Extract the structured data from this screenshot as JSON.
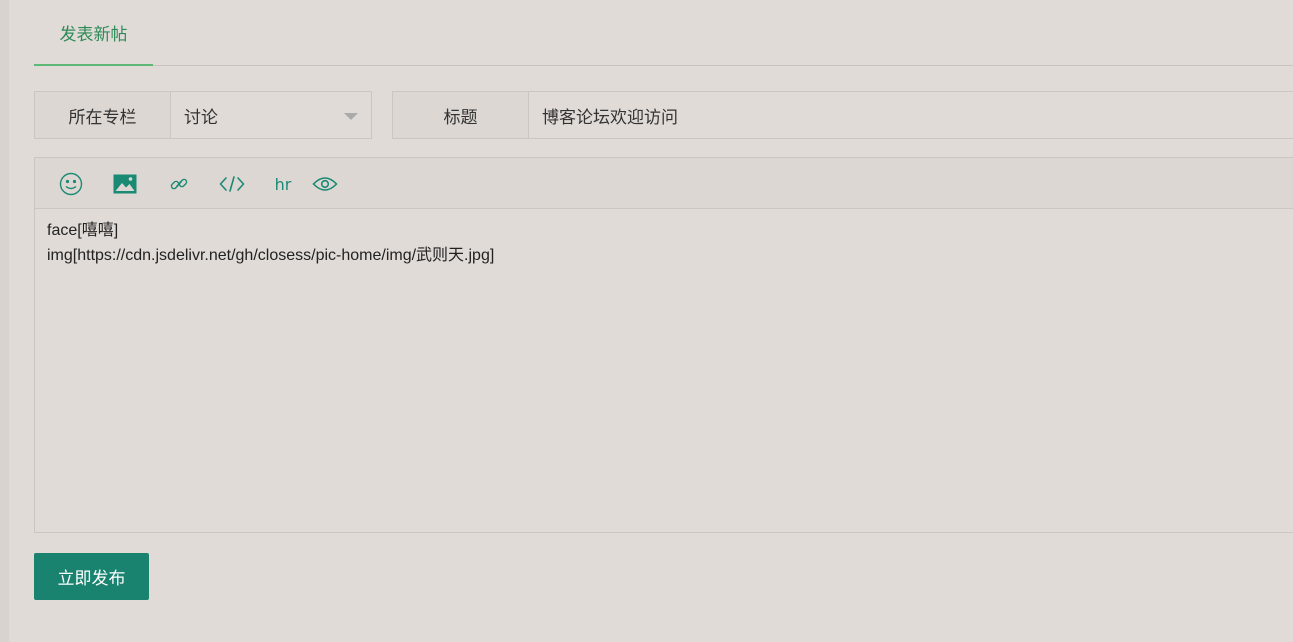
{
  "tabs": [
    {
      "label": "发表新帖",
      "active": true
    }
  ],
  "category": {
    "label": "所在专栏",
    "selected": "讨论"
  },
  "title": {
    "label": "标题",
    "value": "博客论坛欢迎访问"
  },
  "toolbar": {
    "tools": [
      "face-icon",
      "image-icon",
      "link-icon",
      "code-icon",
      "hr",
      "preview-icon"
    ],
    "hr_label": "hr"
  },
  "editor": {
    "content": "face[嘻嘻]\nimg[https://cdn.jsdelivr.net/gh/closess/pic-home/img/武则天.jpg]"
  },
  "publish_label": "立即发布",
  "colors": {
    "accent": "#1a8370",
    "tab_active": "#2e8b57",
    "background": "#e0dbd7"
  }
}
